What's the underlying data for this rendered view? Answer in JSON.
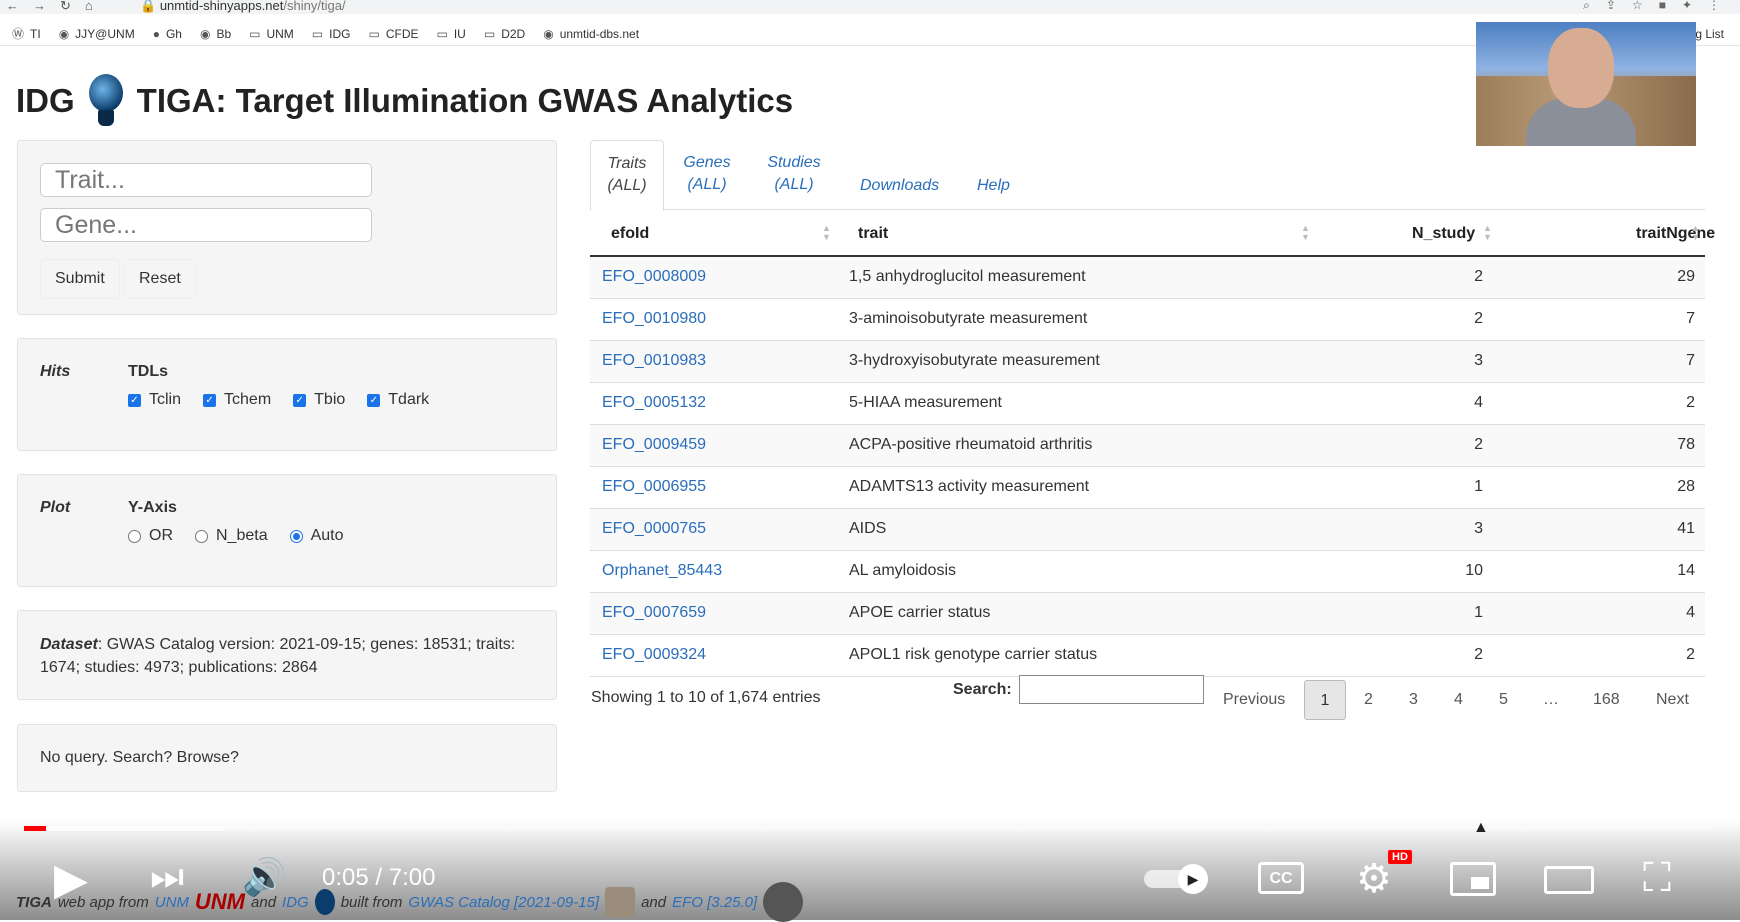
{
  "browser": {
    "url_host": "unmtid-shinyapps.net",
    "url_path": "/shiny/tiga/",
    "bookmarks": [
      "TI",
      "JJY@UNM",
      "Gh",
      "Bb",
      "UNM",
      "IDG",
      "CFDE",
      "IU",
      "D2D",
      "unmtid-dbs.net"
    ],
    "reading_list": "g List"
  },
  "header": {
    "logo_text": "IDG",
    "title": "TIGA: Target Illumination GWAS Analytics"
  },
  "query": {
    "trait_placeholder": "Trait...",
    "gene_placeholder": "Gene...",
    "submit": "Submit",
    "reset": "Reset"
  },
  "hits": {
    "label": "Hits",
    "tdl_label": "TDLs",
    "tdls": [
      "Tclin",
      "Tchem",
      "Tbio",
      "Tdark"
    ]
  },
  "plot": {
    "label": "Plot",
    "yaxis_label": "Y-Axis",
    "options": [
      "OR",
      "N_beta",
      "Auto"
    ],
    "selected": "Auto"
  },
  "dataset": {
    "label": "Dataset",
    "text": ": GWAS Catalog version: 2021-09-15; genes: 18531; traits: 1674; studies: 4973; publications: 2864"
  },
  "status": {
    "text": "No query. Search? Browse?"
  },
  "tabs": [
    {
      "line1": "Traits",
      "line2": "(ALL)"
    },
    {
      "line1": "Genes",
      "line2": "(ALL)"
    },
    {
      "line1": "Studies",
      "line2": "(ALL)"
    },
    {
      "line1": "Downloads",
      "line2": ""
    },
    {
      "line1": "Help",
      "line2": ""
    }
  ],
  "table": {
    "columns": [
      "efoId",
      "trait",
      "N_study",
      "traitNgene"
    ],
    "rows": [
      [
        "EFO_0008009",
        "1,5 anhydroglucitol measurement",
        "2",
        "29"
      ],
      [
        "EFO_0010980",
        "3-aminoisobutyrate measurement",
        "2",
        "7"
      ],
      [
        "EFO_0010983",
        "3-hydroxyisobutyrate measurement",
        "3",
        "7"
      ],
      [
        "EFO_0005132",
        "5-HIAA measurement",
        "4",
        "2"
      ],
      [
        "EFO_0009459",
        "ACPA-positive rheumatoid arthritis",
        "2",
        "78"
      ],
      [
        "EFO_0006955",
        "ADAMTS13 activity measurement",
        "1",
        "28"
      ],
      [
        "EFO_0000765",
        "AIDS",
        "3",
        "41"
      ],
      [
        "Orphanet_85443",
        "AL amyloidosis",
        "10",
        "14"
      ],
      [
        "EFO_0007659",
        "APOE carrier status",
        "1",
        "4"
      ],
      [
        "EFO_0009324",
        "APOL1 risk genotype carrier status",
        "2",
        "2"
      ]
    ],
    "info": "Showing 1 to 10 of 1,674 entries",
    "search_label": "Search:",
    "pager": {
      "previous": "Previous",
      "pages": [
        "1",
        "2",
        "3",
        "4",
        "5",
        "…",
        "168"
      ],
      "current": "1",
      "next": "Next"
    }
  },
  "footer": {
    "app": "TIGA",
    "text1": "web app from",
    "unm": "UNM",
    "and1": "and",
    "idg": "IDG",
    "built": "built from",
    "gwas": "GWAS Catalog [2021-09-15]",
    "and2": "and",
    "efo": "EFO [3.25.0]"
  },
  "player": {
    "time": "0:05 / 7:00",
    "hd_badge": "HD",
    "progress_fraction": 0.013,
    "buffered_fraction": 0.118,
    "colors": {
      "played": "#ff0000"
    }
  }
}
